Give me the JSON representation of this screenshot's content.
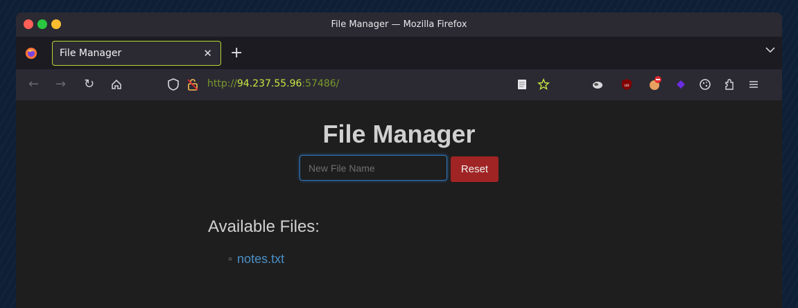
{
  "window": {
    "title": "File Manager — Mozilla Firefox"
  },
  "tab": {
    "title": "File Manager"
  },
  "url": {
    "scheme": "http://",
    "host": "94.237.55.96",
    "rest": ":57486/"
  },
  "page": {
    "heading": "File Manager",
    "input_placeholder": "New File Name",
    "reset_label": "Reset",
    "files_heading": "Available Files:",
    "files": [
      "notes.txt"
    ]
  },
  "colors": {
    "accent_tab_border": "#b8d832",
    "reset_button": "#a02424",
    "link": "#4a90c8",
    "input_focus": "#2f74b8"
  },
  "icons": [
    "firefox-logo-icon",
    "close-icon",
    "plus-icon",
    "chevron-down-icon",
    "back-icon",
    "forward-icon",
    "reload-icon",
    "home-icon",
    "shield-icon",
    "insecure-lock-icon",
    "reader-view-icon",
    "star-icon"
  ]
}
